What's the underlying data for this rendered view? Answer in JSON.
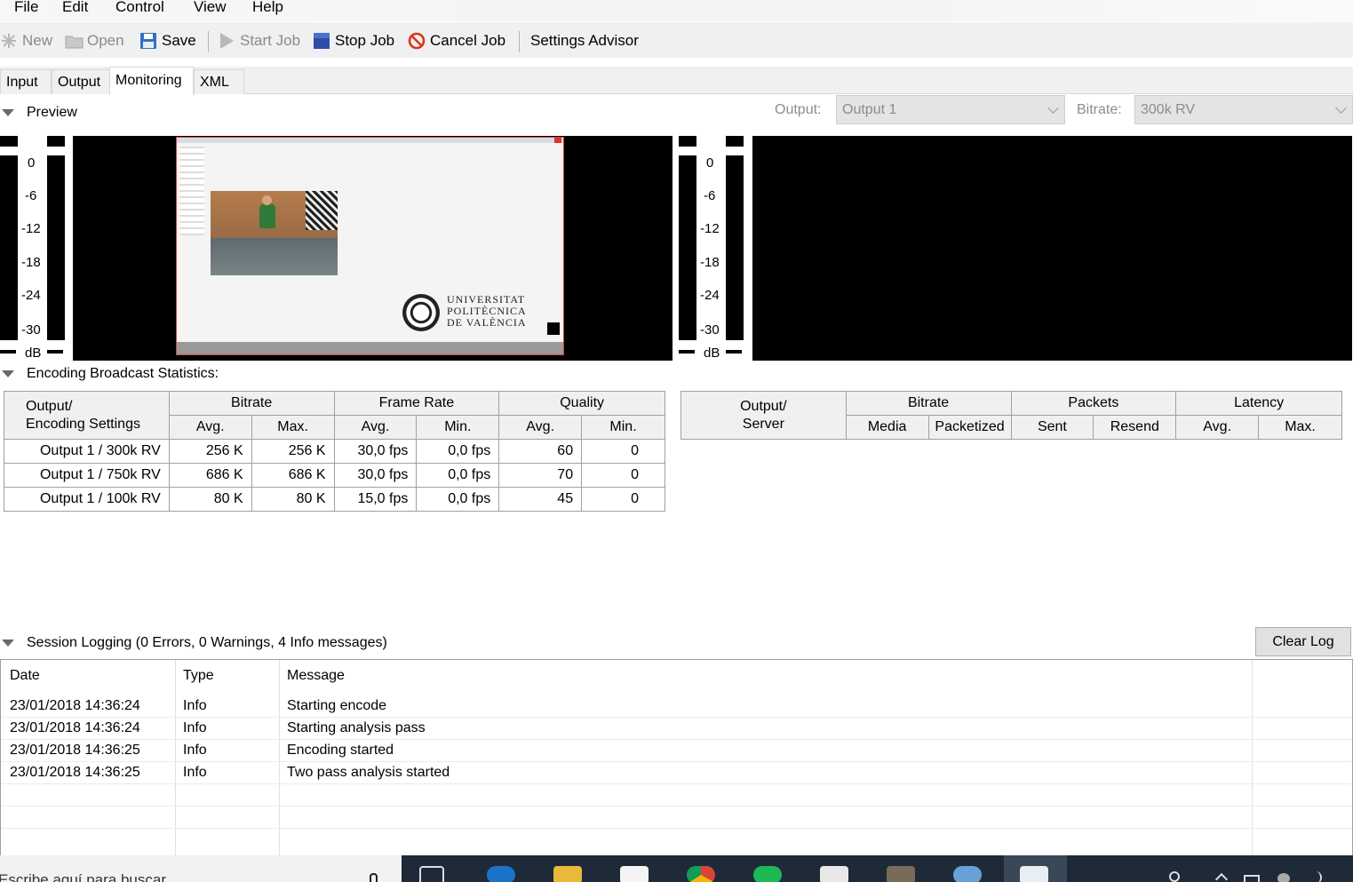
{
  "menu": [
    "File",
    "Edit",
    "Control",
    "View",
    "Help"
  ],
  "toolbar": {
    "new": "New",
    "open": "Open",
    "save": "Save",
    "start_job": "Start Job",
    "stop_job": "Stop Job",
    "cancel_job": "Cancel Job",
    "settings_advisor": "Settings Advisor"
  },
  "tabs": [
    "Input",
    "Output",
    "Monitoring",
    "XML"
  ],
  "preview": {
    "title": "Preview",
    "output_label": "Output:",
    "output_value": "Output 1",
    "bitrate_label": "Bitrate:",
    "bitrate_value": "300k RV",
    "meter_scale": [
      "0",
      "-6",
      "-12",
      "-18",
      "-24",
      "-30"
    ],
    "meter_unit": "dB",
    "overlay_logo_text": [
      "UNIVERSITAT",
      "POLITÈCNICA",
      "DE VALÈNCIA"
    ]
  },
  "encoding": {
    "title": "Encoding  Broadcast Statistics:",
    "headers": {
      "output": "Output/",
      "output2": "Encoding Settings",
      "bitrate": "Bitrate",
      "frame_rate": "Frame Rate",
      "quality": "Quality",
      "avg": "Avg.",
      "max": "Max.",
      "min": "Min."
    },
    "rows": [
      [
        "Output 1 / 300k RV",
        "256 K",
        "256 K",
        "30,0 fps",
        "0,0 fps",
        "60",
        "0"
      ],
      [
        "Output 1 / 750k RV",
        "686 K",
        "686 K",
        "30,0 fps",
        "0,0 fps",
        "70",
        "0"
      ],
      [
        "Output 1 / 100k RV",
        "80 K",
        "80 K",
        "15,0 fps",
        "0,0 fps",
        "45",
        "0"
      ]
    ]
  },
  "broadcast": {
    "headers": {
      "output": "Output/",
      "server": "Server",
      "bitrate": "Bitrate",
      "packets": "Packets",
      "latency": "Latency",
      "media": "Media",
      "packetized": "Packetized",
      "sent": "Sent",
      "resend": "Resend",
      "avg": "Avg.",
      "max": "Max."
    }
  },
  "log": {
    "title": "Session Logging (0 Errors, 0 Warnings, 4 Info messages)",
    "clear_label": "Clear Log",
    "columns": [
      "Date",
      "Type",
      "Message"
    ],
    "entries": [
      [
        "23/01/2018 14:36:24",
        "Info",
        "Starting encode"
      ],
      [
        "23/01/2018 14:36:24",
        "Info",
        "Starting analysis pass"
      ],
      [
        "23/01/2018 14:36:25",
        "Info",
        "Encoding started"
      ],
      [
        "23/01/2018 14:36:25",
        "Info",
        "Two pass analysis started"
      ]
    ]
  },
  "taskbar": {
    "search_placeholder": "Escribe aquí para buscar"
  }
}
